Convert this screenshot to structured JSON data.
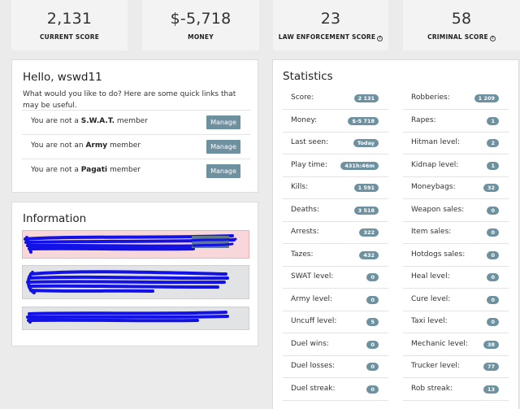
{
  "top_stats": [
    {
      "value": "2,131",
      "label": "CURRENT SCORE",
      "help": false
    },
    {
      "value": "$-5,718",
      "label": "MONEY",
      "help": false
    },
    {
      "value": "23",
      "label": "LAW ENFORCEMENT SCORE",
      "help": true
    },
    {
      "value": "58",
      "label": "CRIMINAL SCORE",
      "help": true
    }
  ],
  "help_glyph": "?",
  "hello": {
    "greeting": "Hello, wswd11",
    "intro": "What would you like to do? Here are some quick links that may be useful.",
    "memberships": [
      {
        "prefix": "You are not a ",
        "group": "S.W.A.T.",
        "suffix": " member",
        "button": "Manage"
      },
      {
        "prefix": "You are not an ",
        "group": "Army",
        "suffix": " member",
        "button": "Manage"
      },
      {
        "prefix": "You are not a ",
        "group": "Pagati",
        "suffix": " member",
        "button": "Manage"
      }
    ]
  },
  "information": {
    "title": "Information",
    "alert_colors": {
      "danger": "#f8d7da",
      "neutral": "#e2e3e5",
      "scribble": "#1212e6"
    }
  },
  "statistics": {
    "title": "Statistics",
    "left": [
      {
        "label": "Score:",
        "value": "2 131"
      },
      {
        "label": "Money:",
        "value": "$-5 718"
      },
      {
        "label": "Last seen:",
        "value": "Today"
      },
      {
        "label": "Play time:",
        "value": "431h:46m"
      },
      {
        "label": "Kills:",
        "value": "1 591"
      },
      {
        "label": "Deaths:",
        "value": "3 518"
      },
      {
        "label": "Arrests:",
        "value": "322"
      },
      {
        "label": "Tazes:",
        "value": "432"
      },
      {
        "label": "SWAT level:",
        "value": "0"
      },
      {
        "label": "Army level:",
        "value": "0"
      },
      {
        "label": "Uncuff level:",
        "value": "5"
      },
      {
        "label": "Duel wins:",
        "value": "0"
      },
      {
        "label": "Duel losses:",
        "value": "0"
      },
      {
        "label": "Duel streak:",
        "value": "0"
      }
    ],
    "right": [
      {
        "label": "Robberies:",
        "value": "1 209"
      },
      {
        "label": "Rapes:",
        "value": "1"
      },
      {
        "label": "Hitman level:",
        "value": "2"
      },
      {
        "label": "Kidnap level:",
        "value": "1"
      },
      {
        "label": "Moneybags:",
        "value": "32"
      },
      {
        "label": "Weapon sales:",
        "value": "0"
      },
      {
        "label": "Item sales:",
        "value": "0"
      },
      {
        "label": "Hotdogs sales:",
        "value": "0"
      },
      {
        "label": "Heal level:",
        "value": "0"
      },
      {
        "label": "Cure level:",
        "value": "0"
      },
      {
        "label": "Taxi level:",
        "value": "0"
      },
      {
        "label": "Mechanic level:",
        "value": "38"
      },
      {
        "label": "Trucker level:",
        "value": "77"
      },
      {
        "label": "Rob streak:",
        "value": "13"
      }
    ]
  },
  "colors": {
    "badge": "#6e91a0",
    "button": "#6e91a0",
    "page_bg": "#ebebeb"
  }
}
